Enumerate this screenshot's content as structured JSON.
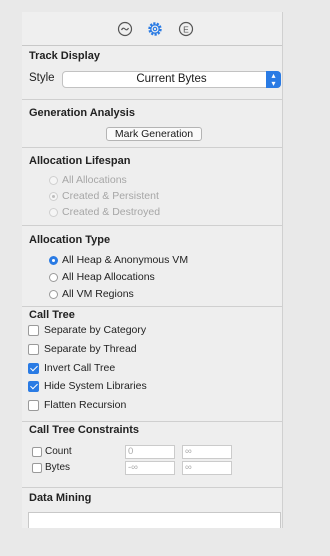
{
  "tabs": [
    {
      "icon": "clock-icon"
    },
    {
      "icon": "gear-icon",
      "active": true
    },
    {
      "icon": "extended-detail-icon",
      "glyph": "E"
    }
  ],
  "track_display": {
    "title": "Track Display",
    "style_label": "Style",
    "style_value": "Current Bytes"
  },
  "generation_analysis": {
    "title": "Generation Analysis",
    "button_label": "Mark Generation"
  },
  "allocation_lifespan": {
    "title": "Allocation Lifespan",
    "options": [
      "All Allocations",
      "Created & Persistent",
      "Created & Destroyed"
    ]
  },
  "allocation_type": {
    "title": "Allocation Type",
    "options": [
      "All Heap & Anonymous VM",
      "All Heap Allocations",
      "All VM Regions"
    ]
  },
  "call_tree": {
    "title": "Call Tree",
    "options": [
      {
        "label": "Separate by Category",
        "checked": false
      },
      {
        "label": "Separate by Thread",
        "checked": false
      },
      {
        "label": "Invert Call Tree",
        "checked": true
      },
      {
        "label": "Hide System Libraries",
        "checked": true
      },
      {
        "label": "Flatten Recursion",
        "checked": false
      }
    ]
  },
  "call_tree_constraints": {
    "title": "Call Tree Constraints",
    "count_label": "Count",
    "count_min": "0",
    "count_max": "∞",
    "bytes_label": "Bytes",
    "bytes_min": "-∞",
    "bytes_max": "∞"
  },
  "data_mining": {
    "title": "Data Mining"
  }
}
